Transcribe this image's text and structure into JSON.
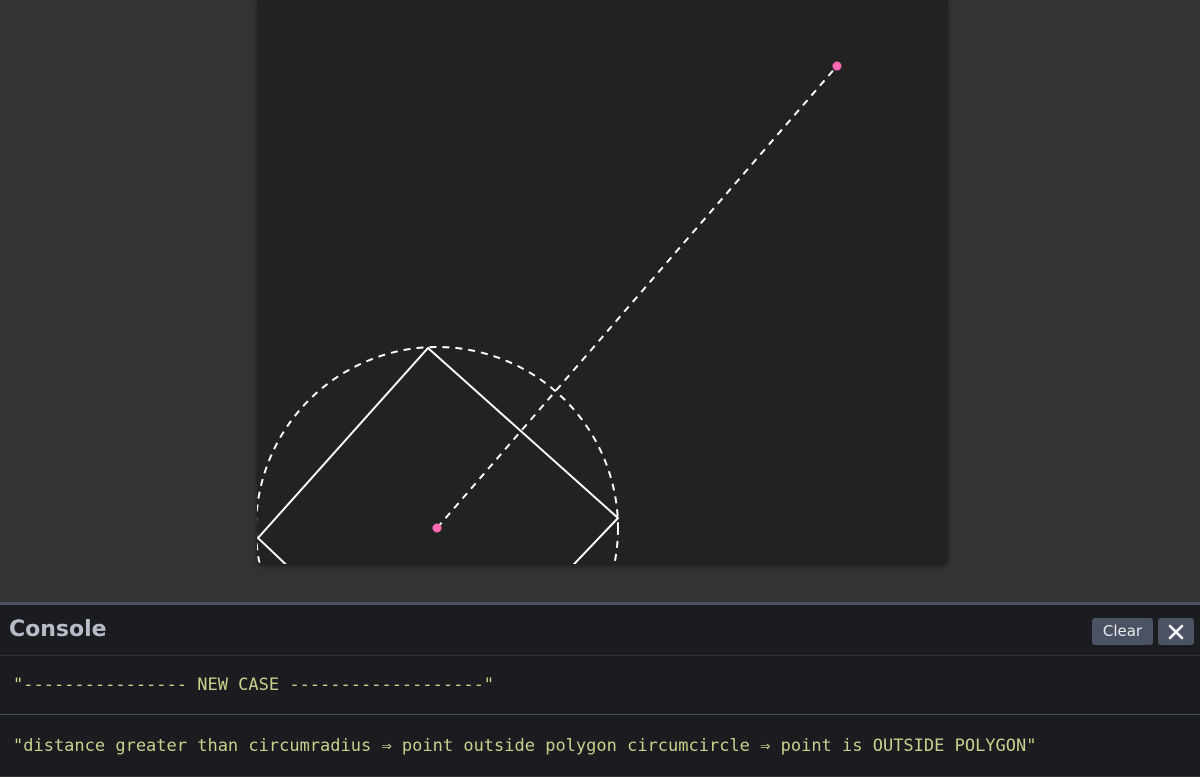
{
  "console": {
    "title": "Console",
    "clear_label": "Clear",
    "close_icon": "close-icon",
    "logs": [
      "\"---------------- NEW CASE -------------------\"",
      "\"distance greater than circumradius ⇒ point outside polygon circumcircle ⇒ point is OUTSIDE POLYGON\""
    ]
  },
  "scene": {
    "point_color": "#ff69b4",
    "stroke_color": "#ffffff",
    "background": "#222222",
    "page_background": "#333333"
  }
}
